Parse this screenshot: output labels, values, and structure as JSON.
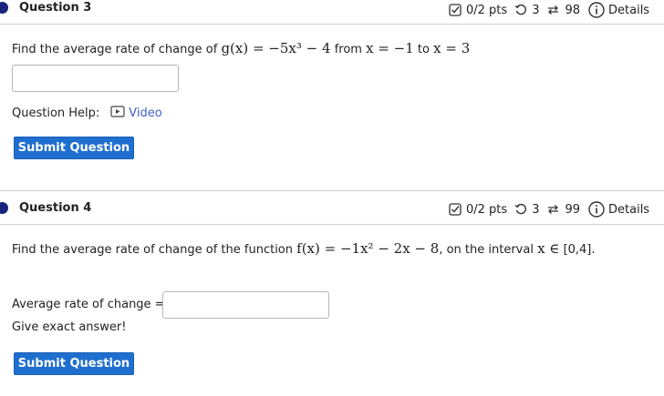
{
  "questions": [
    {
      "title": "Question 3",
      "score": "0/2 pts",
      "attempts": "3",
      "versions": "98",
      "details_label": "Details",
      "prompt_prefix": "Find the average rate of change of",
      "function_math": "g(x) = −5x³ − 4",
      "from_label": "from",
      "from_math": "x = −1",
      "to_label": "to",
      "to_math": "x = 3",
      "help_label": "Question Help:",
      "video_label": "Video",
      "submit_label": "Submit Question"
    },
    {
      "title": "Question 4",
      "score": "0/2 pts",
      "attempts": "3",
      "versions": "99",
      "details_label": "Details",
      "prompt_prefix": "Find the average rate of change of the function",
      "function_math": "f(x) = −1x² − 2x − 8",
      "interval_text": ", on the interval",
      "interval_math": "x ∈",
      "interval_value": "[0,4].",
      "answer_label": "Average rate of change =",
      "hint": "Give exact answer!",
      "submit_label": "Submit Question"
    }
  ],
  "colors": {
    "dot": "#1a237e",
    "button": "#1f6fd0",
    "link": "#3f5fc7",
    "divider": "#cfcfcf"
  }
}
